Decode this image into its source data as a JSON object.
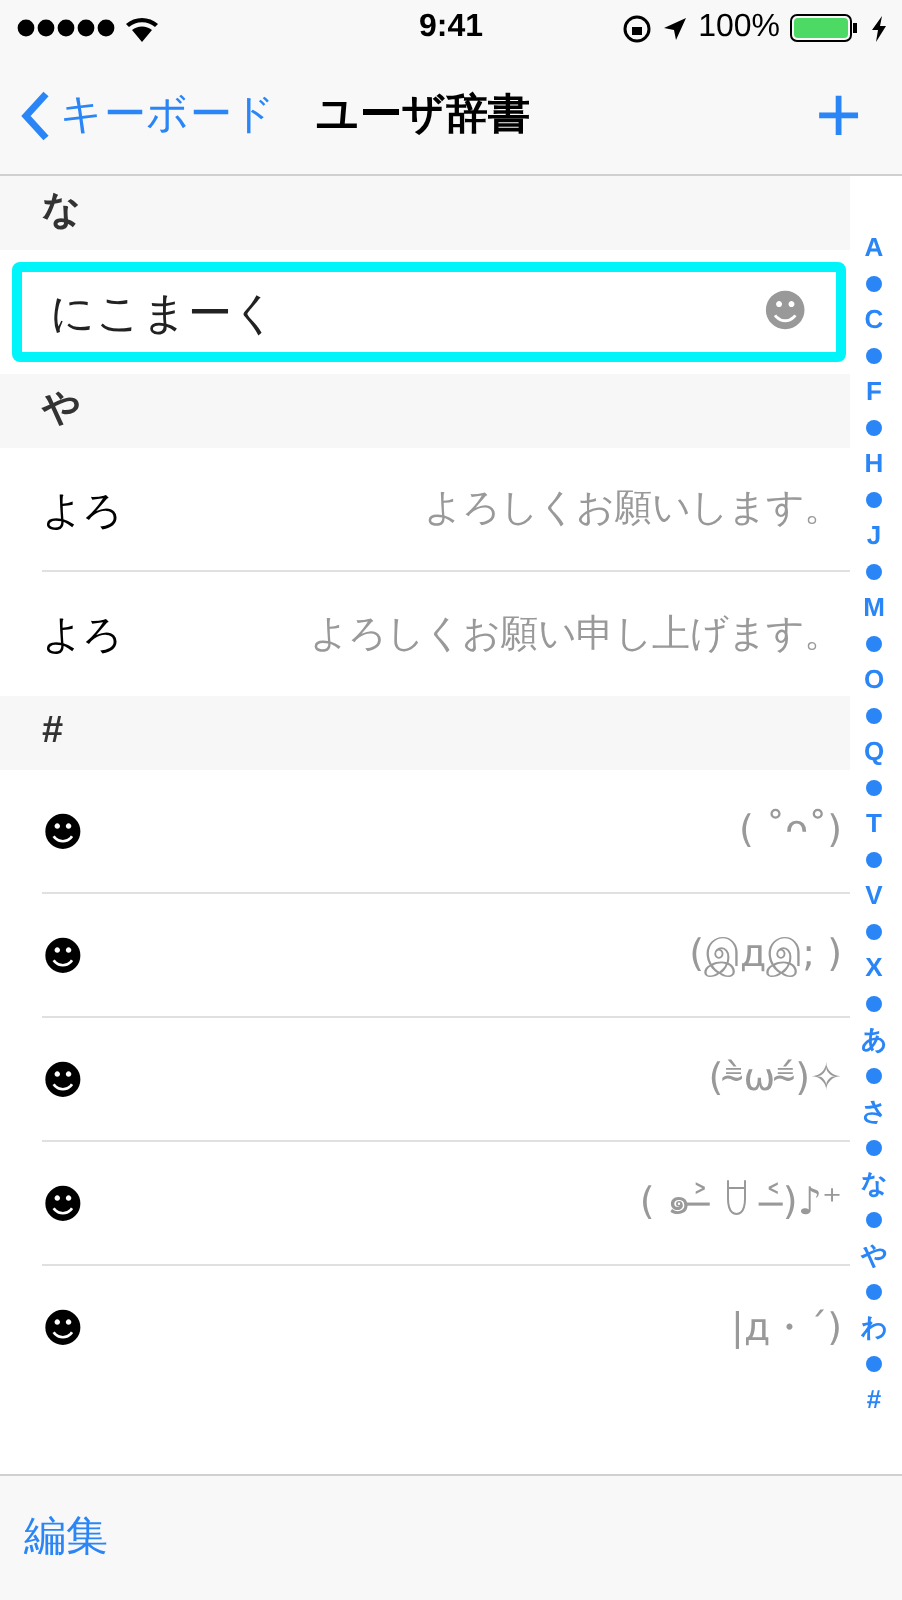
{
  "status_bar": {
    "time": "9:41",
    "battery": "100%"
  },
  "nav": {
    "back": "キーボード",
    "title": "ユーザ辞書",
    "add": "+"
  },
  "sections": [
    {
      "header": "な",
      "rows": [
        {
          "kind": "editing",
          "reading": "にこまーく",
          "phrase": "☻",
          "focused": true
        }
      ]
    },
    {
      "header": "や",
      "rows": [
        {
          "kind": "entry",
          "reading": "よろ",
          "phrase": "よろしくお願いします。",
          "focused": false
        },
        {
          "kind": "entry",
          "reading": "よろ",
          "phrase": "よろしくお願い申し上げます。",
          "focused": false
        }
      ]
    },
    {
      "header": "#",
      "rows": [
        {
          "kind": "entry",
          "reading": "☻",
          "phrase": "( ˚ᴖ˚)",
          "focused": false
        },
        {
          "kind": "entry",
          "reading": "☻",
          "phrase": "(இдஇ; )",
          "focused": false
        },
        {
          "kind": "entry",
          "reading": "☻",
          "phrase": "(⁼̴̀ω⁼̴́)✧",
          "focused": false
        },
        {
          "kind": "entry",
          "reading": "☻",
          "phrase": "( ๑˃̶ ꇴ ˂̶)♪⁺",
          "focused": false
        },
        {
          "kind": "entry",
          "reading": "☻",
          "phrase": "|д・´)",
          "focused": false
        }
      ]
    }
  ],
  "index": [
    "A",
    "C",
    "F",
    "H",
    "J",
    "M",
    "O",
    "Q",
    "T",
    "V",
    "X",
    "あ",
    "さ",
    "な",
    "や",
    "わ",
    "#"
  ],
  "toolbar": {
    "edit": "編集"
  }
}
